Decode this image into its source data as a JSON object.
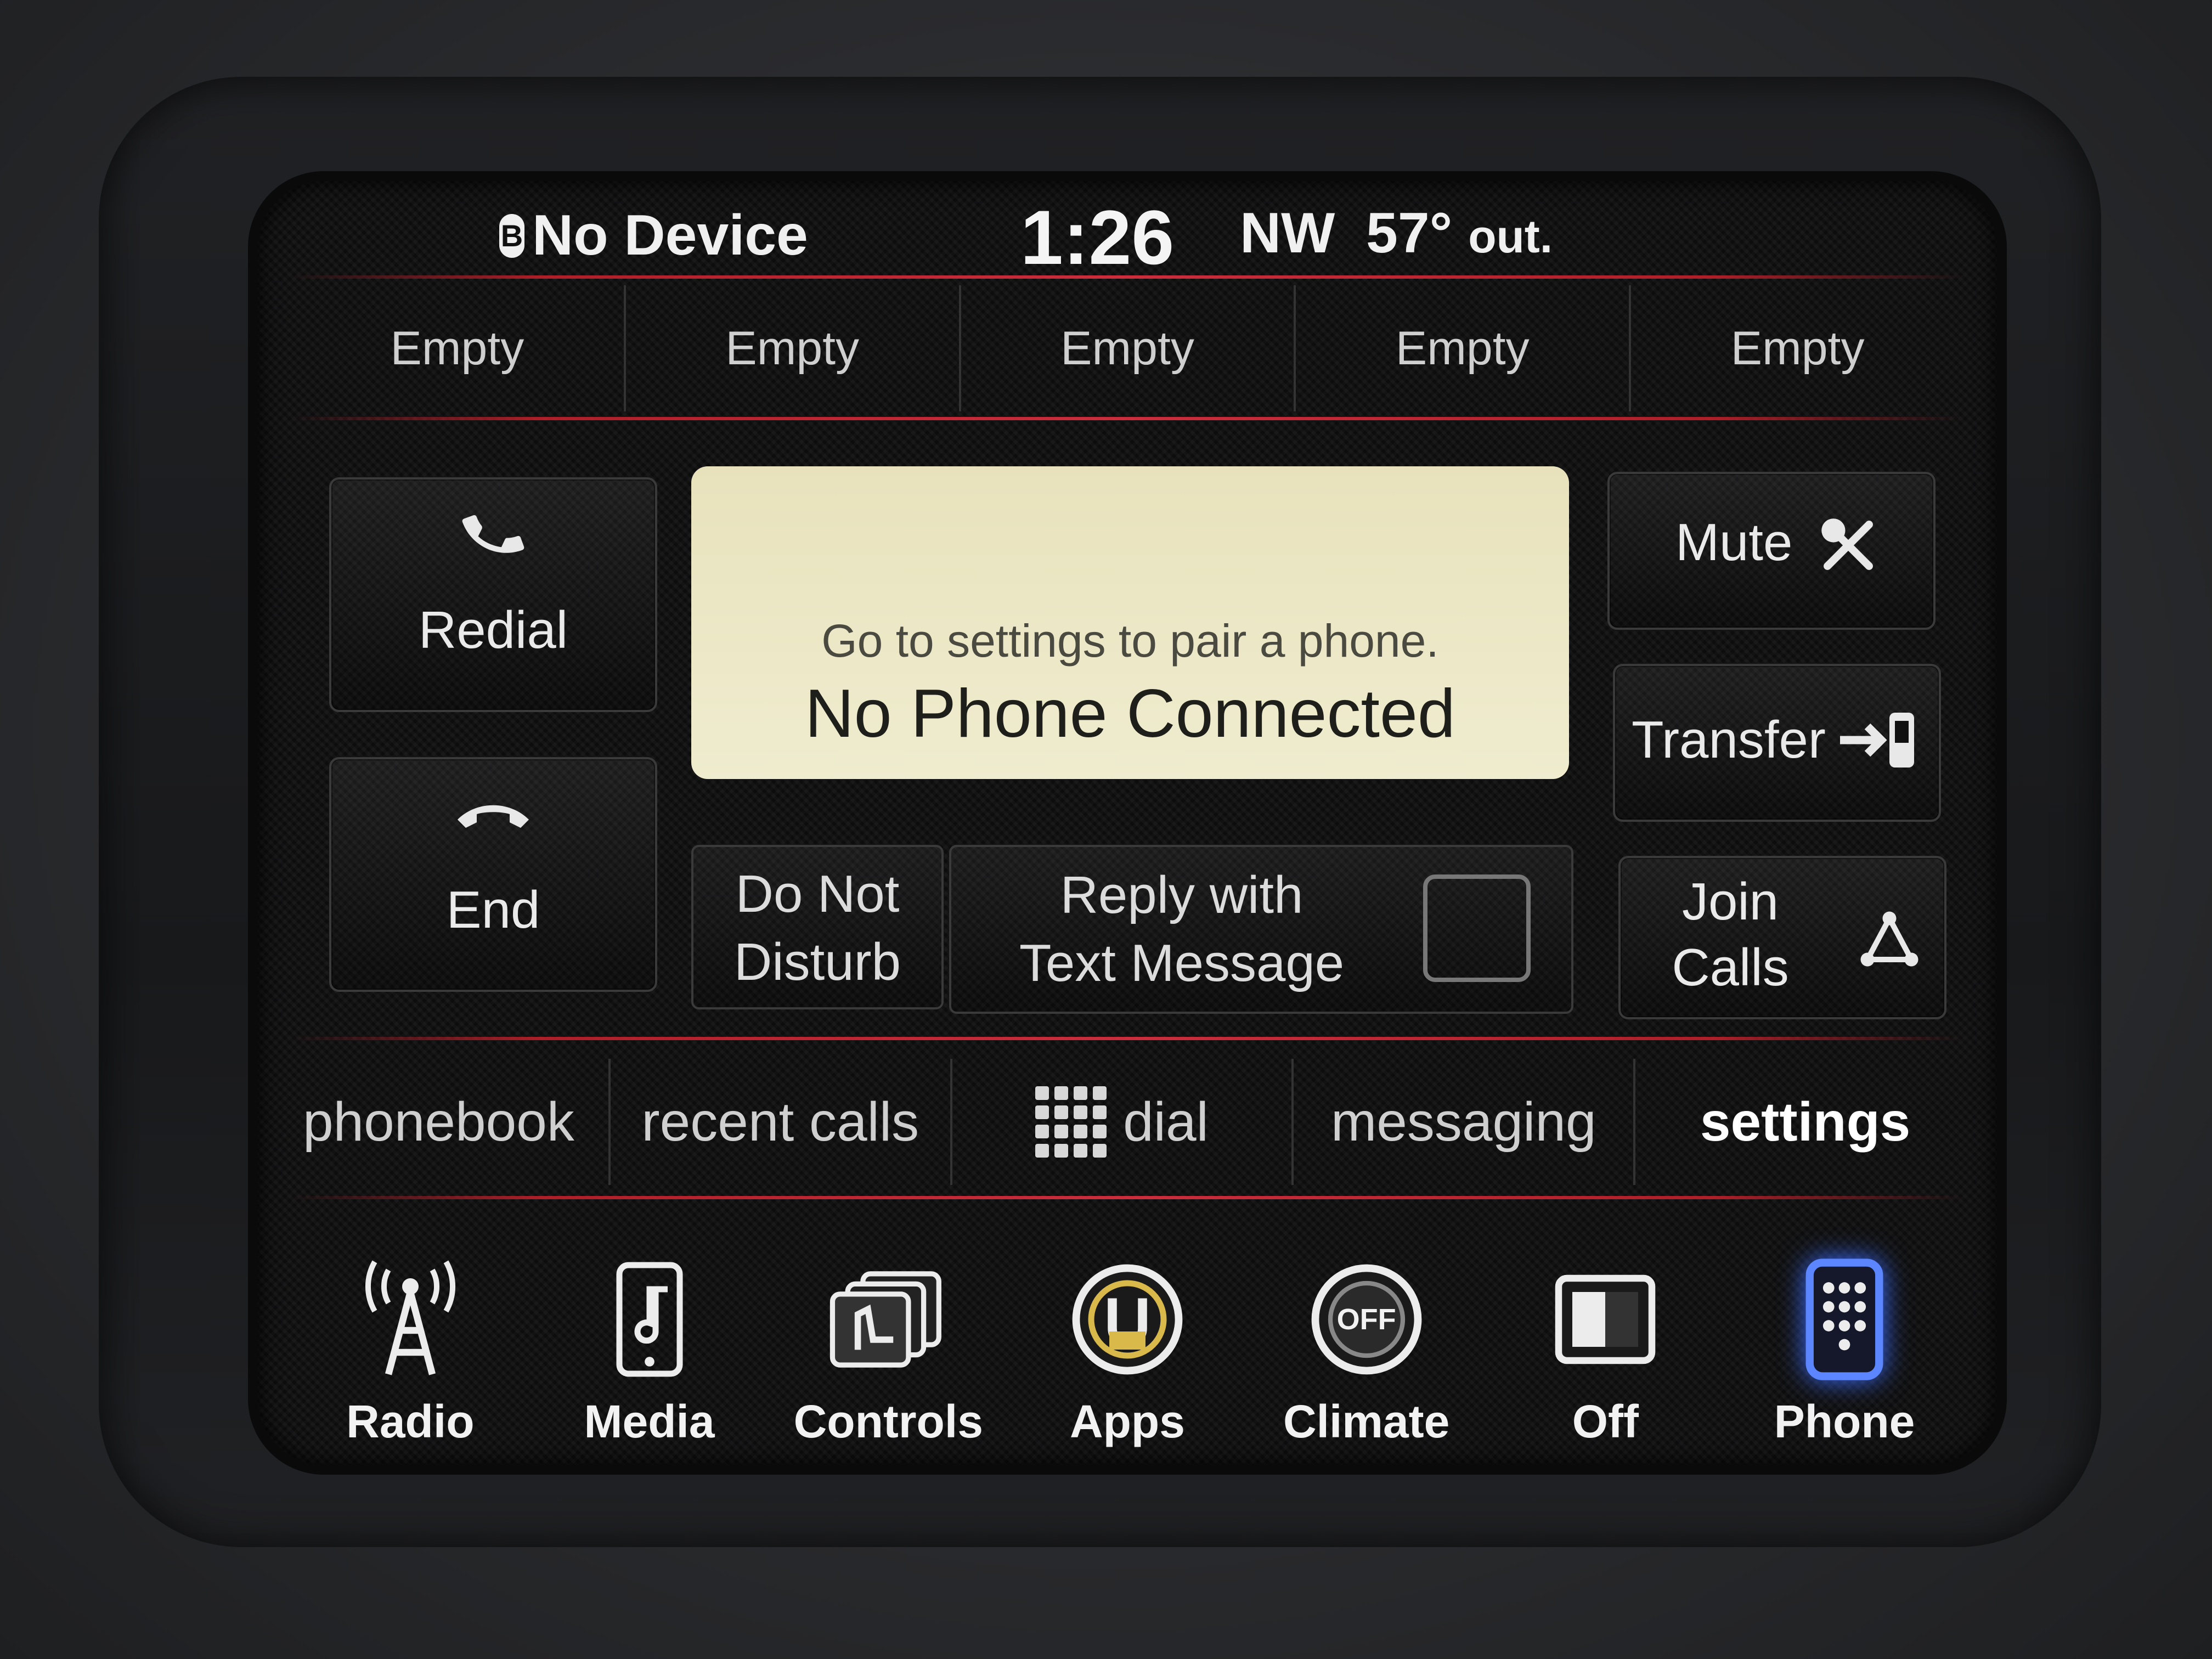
{
  "status": {
    "device": "No Device",
    "bt_glyph": "B",
    "time": "1:26",
    "compass": "NW",
    "temperature": "57°",
    "temperature_suffix": "out."
  },
  "favorites": [
    "Empty",
    "Empty",
    "Empty",
    "Empty",
    "Empty"
  ],
  "left_buttons": {
    "redial": "Redial",
    "end": "End"
  },
  "message": {
    "hint": "Go to settings to pair a phone.",
    "main": "No Phone Connected"
  },
  "right_buttons": {
    "mute": "Mute",
    "transfer": "Transfer",
    "join_line1": "Join",
    "join_line2": "Calls"
  },
  "options": {
    "dnd_line1": "Do Not",
    "dnd_line2": "Disturb",
    "reply_line1": "Reply with",
    "reply_line2": "Text Message"
  },
  "tabs": [
    {
      "label": "phonebook"
    },
    {
      "label": "recent calls"
    },
    {
      "label": "dial"
    },
    {
      "label": "messaging"
    },
    {
      "label": "settings"
    }
  ],
  "dock": [
    {
      "label": "Radio",
      "icon": "radio-tower-icon"
    },
    {
      "label": "Media",
      "icon": "media-phone-note-icon"
    },
    {
      "label": "Controls",
      "icon": "seat-controls-icon"
    },
    {
      "label": "Apps",
      "icon": "apps-icon"
    },
    {
      "label": "Climate",
      "icon": "climate-off-icon"
    },
    {
      "label": "Off",
      "icon": "screen-off-icon"
    },
    {
      "label": "Phone",
      "icon": "phone-icon"
    }
  ],
  "off_badge": "OFF",
  "colors": {
    "accent_red": "#e03040",
    "active_glow": "#3a6cff",
    "message_bg": "#efeccf"
  }
}
